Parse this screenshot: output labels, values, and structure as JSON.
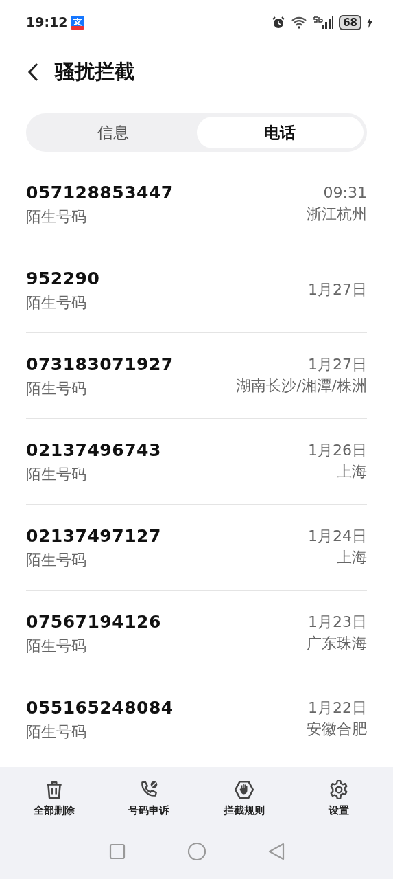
{
  "status_bar": {
    "time": "19:12",
    "battery": "68"
  },
  "header": {
    "title": "骚扰拦截"
  },
  "tabs": [
    {
      "label": "信息",
      "selected": false
    },
    {
      "label": "电话",
      "selected": true
    }
  ],
  "calls": [
    {
      "number": "057128853447",
      "label": "陌生号码",
      "time": "09:31",
      "location": "浙江杭州"
    },
    {
      "number": "952290",
      "label": "陌生号码",
      "time": "1月27日"
    },
    {
      "number": "073183071927",
      "label": "陌生号码",
      "time": "1月27日",
      "location": "湖南长沙/湘潭/株洲"
    },
    {
      "number": "02137496743",
      "label": "陌生号码",
      "time": "1月26日",
      "location": "上海"
    },
    {
      "number": "02137497127",
      "label": "陌生号码",
      "time": "1月24日",
      "location": "上海"
    },
    {
      "number": "07567194126",
      "label": "陌生号码",
      "time": "1月23日",
      "location": "广东珠海"
    },
    {
      "number": "055165248084",
      "label": "陌生号码",
      "time": "1月22日",
      "location": "安徽合肥"
    }
  ],
  "toolbar": [
    {
      "kind": "delete",
      "label": "全部删除"
    },
    {
      "kind": "appeal",
      "label": "号码申诉"
    },
    {
      "kind": "rules",
      "label": "拦截规则"
    },
    {
      "kind": "settings",
      "label": "设置"
    }
  ]
}
